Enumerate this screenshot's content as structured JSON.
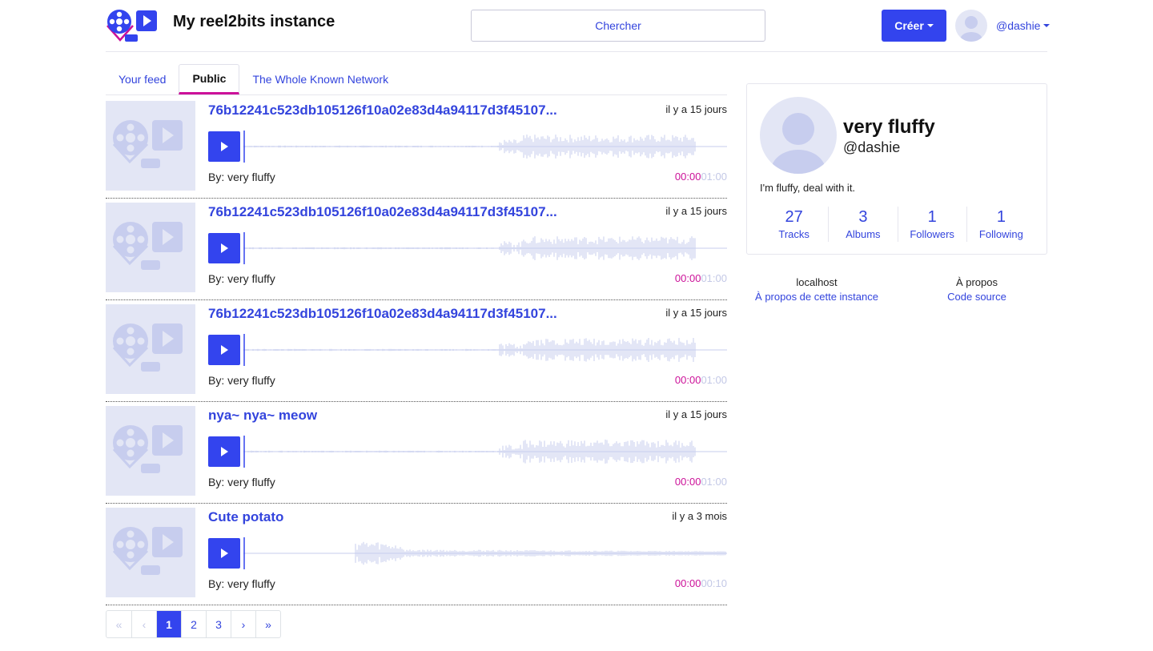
{
  "header": {
    "site_title": "My reel2bits instance",
    "search_label": "Chercher",
    "create_label": "Créer",
    "username": "@dashie",
    "logo_icon": "reel2bits-logo-icon",
    "avatar_icon": "user-avatar-icon"
  },
  "tabs": [
    {
      "label": "Your feed",
      "active": false
    },
    {
      "label": "Public",
      "active": true
    },
    {
      "label": "The Whole Known Network",
      "active": false
    }
  ],
  "tracks": [
    {
      "title": "76b12241c523db105126f10a02e83d4a94117d3f45107...",
      "time": "il y a 15 jours",
      "by": "By: very fluffy",
      "current": "00:00",
      "duration": "01:00"
    },
    {
      "title": "76b12241c523db105126f10a02e83d4a94117d3f45107...",
      "time": "il y a 15 jours",
      "by": "By: very fluffy",
      "current": "00:00",
      "duration": "01:00"
    },
    {
      "title": "76b12241c523db105126f10a02e83d4a94117d3f45107...",
      "time": "il y a 15 jours",
      "by": "By: very fluffy",
      "current": "00:00",
      "duration": "01:00"
    },
    {
      "title": "nya~ nya~ meow",
      "time": "il y a 15 jours",
      "by": "By: very fluffy",
      "current": "00:00",
      "duration": "01:00"
    },
    {
      "title": "Cute potato",
      "time": "il y a 3 mois",
      "by": "By: very fluffy",
      "current": "00:00",
      "duration": "00:10"
    }
  ],
  "pagination": {
    "first": "«",
    "prev": "‹",
    "pages": [
      "1",
      "2",
      "3"
    ],
    "current": "1",
    "next": "›",
    "last": "»"
  },
  "profile": {
    "name": "very fluffy",
    "handle": "@dashie",
    "bio": "I'm fluffy, deal with it.",
    "stats": [
      {
        "value": "27",
        "label": "Tracks"
      },
      {
        "value": "3",
        "label": "Albums"
      },
      {
        "value": "1",
        "label": "Followers"
      },
      {
        "value": "1",
        "label": "Following"
      }
    ]
  },
  "footer": {
    "col1": {
      "head": "localhost",
      "link": "À propos de cette instance"
    },
    "col2": {
      "head": "À propos",
      "link": "Code source"
    }
  },
  "colors": {
    "accent": "#3344ee",
    "link": "#3344dd",
    "progress": "#cc1199",
    "muted": "#c3c8e6",
    "placeholder_bg": "#e3e6f5"
  }
}
